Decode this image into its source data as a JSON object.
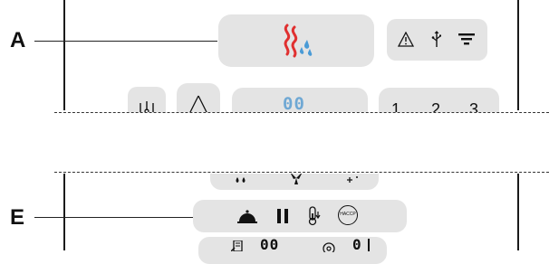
{
  "callouts": [
    {
      "letter": "A"
    },
    {
      "letter": "E"
    }
  ],
  "top_panel": {
    "heat_humidity_icon": "steam-humidity-icon",
    "status_icons": [
      "warning-triangle-icon",
      "usb-icon",
      "filter-icon"
    ],
    "bottom_row": {
      "left_icons": [
        "probe-icon",
        "delta-icon"
      ],
      "display_value": "00",
      "program_numbers": [
        "1",
        "2",
        "3"
      ]
    }
  },
  "bottom_panel": {
    "top_row_icons": [
      "water-drops-icon",
      "fan-icon",
      "sparkle-icon"
    ],
    "row_e_icons": [
      "cloche-icon",
      "pause-icon",
      "thermometer-icon",
      "haccp-icon"
    ],
    "haccp_label": "HACCP",
    "bottom_row": {
      "left_display": "00",
      "right_display": "0"
    }
  },
  "colors": {
    "frame": "#1a1a1a",
    "pill": "#e4e4e4",
    "heat_wave": "#e03030",
    "water_drop": "#4a9bd6",
    "segment": "#6fa8d4"
  }
}
